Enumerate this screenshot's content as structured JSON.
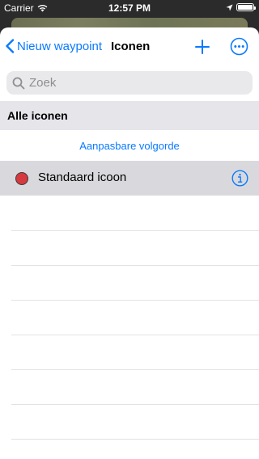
{
  "status_bar": {
    "carrier": "Carrier",
    "time": "12:57 PM",
    "wifi_icon": "wifi-icon",
    "location_icon": "location-arrow-icon",
    "battery_level": 1.0
  },
  "navbar": {
    "back_label": "Nieuw waypoint",
    "title": "Iconen",
    "plus_icon": "plus-icon",
    "more_icon": "ellipsis-circle-icon"
  },
  "search": {
    "placeholder": "Zoek",
    "value": ""
  },
  "section": {
    "header": "Alle iconen",
    "reorder_label": "Aanpasbare volgorde"
  },
  "icons_list": [
    {
      "label": "Standaard icoon",
      "color": "#d6393f",
      "selected": true
    }
  ],
  "colors": {
    "accent": "#0a7aff",
    "selected_row": "#d9d9dd",
    "section_bg": "#e5e5ea"
  }
}
